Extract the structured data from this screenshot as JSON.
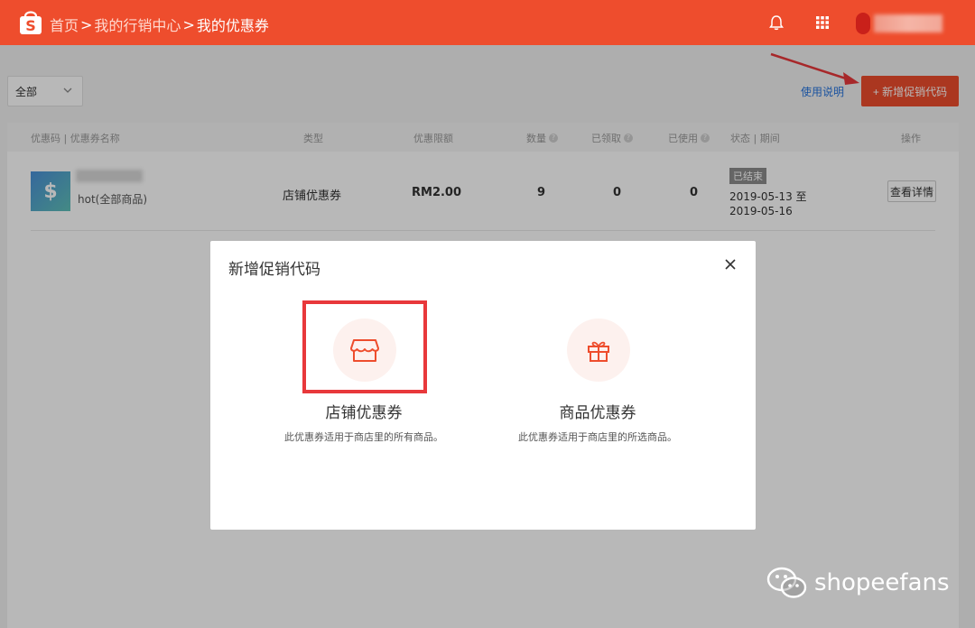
{
  "header": {
    "breadcrumb": [
      "首页",
      "我的行销中心",
      "我的优惠券"
    ],
    "separator": ">"
  },
  "toolbar": {
    "filter_value": "全部",
    "help_label": "使用说明",
    "add_label": "+ 新增促销代码"
  },
  "table": {
    "columns": {
      "code": "优惠码 | 优惠券名称",
      "type": "类型",
      "amount": "优惠限额",
      "quantity": "数量",
      "claimed": "已领取",
      "used": "已使用",
      "status": "状态 | 期间",
      "action": "操作"
    },
    "help_mark": "?",
    "rows": [
      {
        "icon_glyph": "$",
        "name": "hot(全部商品)",
        "type": "店铺优惠券",
        "amount": "RM2.00",
        "quantity": "9",
        "claimed": "0",
        "used": "0",
        "status": "已结束",
        "period_start": "2019-05-13 至",
        "period_end": "2019-05-16",
        "action": "查看详情"
      }
    ]
  },
  "modal": {
    "title": "新增促销代码",
    "options": [
      {
        "title": "店铺优惠券",
        "desc": "此优惠券适用于商店里的所有商品。",
        "icon": "shop-icon"
      },
      {
        "title": "商品优惠券",
        "desc": "此优惠券适用于商店里的所选商品。",
        "icon": "gift-icon"
      }
    ]
  },
  "watermark": {
    "text": "shopeefans"
  },
  "colors": {
    "brand": "#ee4d2d",
    "link": "#2673dd",
    "highlight": "#e8383b"
  }
}
